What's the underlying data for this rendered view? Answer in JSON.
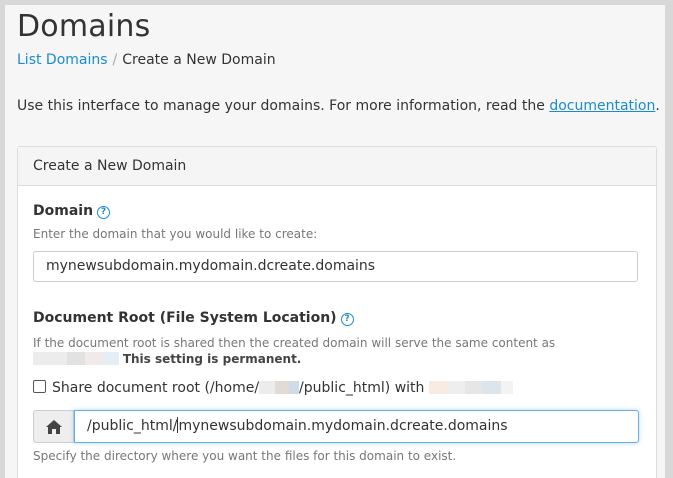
{
  "page": {
    "title": "Domains"
  },
  "breadcrumb": {
    "items": [
      "List Domains",
      "Create a New Domain"
    ],
    "separator": "/"
  },
  "intro": {
    "text": "Use this interface to manage your domains. For more information, read the",
    "link": "documentation",
    "suffix": "."
  },
  "panel": {
    "heading": "Create a New Domain",
    "domain": {
      "label": "Domain",
      "help_icon": "question-circle-icon",
      "hint": "Enter the domain that you would like to create:",
      "value": "mynewsubdomain.mydomain.dcreate.domains"
    },
    "document_root": {
      "label": "Document Root (File System Location)",
      "help_icon": "question-circle-icon",
      "hint_line1": "If the document root is shared then the created domain will serve the same content as",
      "permanent_note": "This setting is permanent.",
      "share_prefix": "Share document root (/home/",
      "share_middle": "/public_html) with",
      "share_checked": false,
      "addon_icon": "home-icon",
      "value_before_caret": "/public_html/",
      "value_after_caret": "mynewsubdomain.mydomain.dcreate.domains",
      "footer_hint": "Specify the directory where you want the files for this domain to exist."
    }
  },
  "colors": {
    "link": "#1a8bd0",
    "focus_border": "#66afe9",
    "background": "#f6f6f6"
  }
}
